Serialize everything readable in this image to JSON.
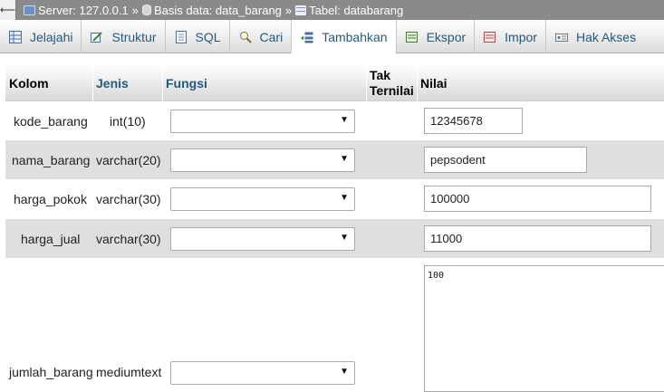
{
  "breadcrumb": {
    "server": "Server: 127.0.0.1",
    "database": "Basis data: data_barang",
    "table": "Tabel: databarang",
    "separator": "»"
  },
  "tabs": [
    {
      "label": "Jelajahi",
      "icon": "browse-icon"
    },
    {
      "label": "Struktur",
      "icon": "structure-icon"
    },
    {
      "label": "SQL",
      "icon": "sql-icon"
    },
    {
      "label": "Cari",
      "icon": "search-icon"
    },
    {
      "label": "Tambahkan",
      "icon": "insert-icon",
      "active": true
    },
    {
      "label": "Ekspor",
      "icon": "export-icon"
    },
    {
      "label": "Impor",
      "icon": "import-icon"
    },
    {
      "label": "Hak Akses",
      "icon": "privileges-icon"
    }
  ],
  "headers": {
    "kolom": "Kolom",
    "jenis": "Jenis",
    "fungsi": "Fungsi",
    "tak_ternilai_1": "Tak",
    "tak_ternilai_2": "Ternilai",
    "nilai": "Nilai"
  },
  "rows": [
    {
      "kolom": "kode_barang",
      "jenis": "int(10)",
      "fungsi": "",
      "nilai": "12345678"
    },
    {
      "kolom": "nama_barang",
      "jenis": "varchar(20)",
      "fungsi": "",
      "nilai": "pepsodent"
    },
    {
      "kolom": "harga_pokok",
      "jenis": "varchar(30)",
      "fungsi": "",
      "nilai": "100000"
    },
    {
      "kolom": "harga_jual",
      "jenis": "varchar(30)",
      "fungsi": "",
      "nilai": "11000"
    },
    {
      "kolom": "jumlah_barang",
      "jenis": "mediumtext",
      "fungsi": "",
      "nilai": "100"
    }
  ],
  "select_caret": "▼",
  "colors": {
    "link": "#235a81",
    "breadcrumb_bg": "#8a8a8a",
    "row_alt": "#dfdfdf"
  }
}
